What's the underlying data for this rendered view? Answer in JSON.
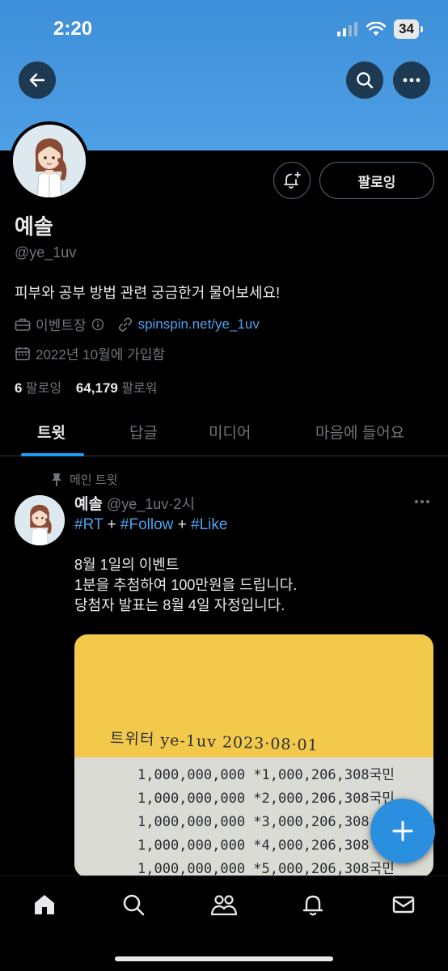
{
  "status_bar": {
    "time": "2:20",
    "battery": "34"
  },
  "header": {
    "back_icon": "back-arrow-icon",
    "search_icon": "search-icon",
    "more_icon": "more-icon"
  },
  "profile": {
    "display_name": "예솔",
    "handle": "@ye_1uv",
    "bio": "피부와 공부 방법 관련 궁금한거 물어보세요!",
    "category": "이벤트장",
    "link": "spinspin.net/ye_1uv",
    "joined": "2022년 10월에 가입함",
    "following_count": "6",
    "following_label": "팔로잉",
    "followers_count": "64,179",
    "followers_label": "팔로워",
    "follow_button": "팔로잉"
  },
  "tabs": [
    {
      "label": "트윗",
      "active": true
    },
    {
      "label": "답글",
      "active": false
    },
    {
      "label": "미디어",
      "active": false
    },
    {
      "label": "마음에 들어요",
      "active": false
    }
  ],
  "tweet": {
    "pinned_label": "메인 트윗",
    "author_name": "예솔",
    "author_handle": "@ye_1uv",
    "time": "·2시",
    "hashtag1": "#RT",
    "hashtag2": "#Follow",
    "hashtag3": "#Like",
    "plus": "+",
    "line1": "8월 1일의 이벤트",
    "line2": "1분을 추첨하여 100만원을 드립니다.",
    "line3": "당첨자 발표는 8월 4일 자정입니다.",
    "media_handwriting": "트위터 ye-1uv  2023·08·01",
    "media_rows": [
      "1,000,000,000 *1,000,206,308국민",
      "1,000,000,000 *2,000,206,308국민",
      "1,000,000,000 *3,000,206,308",
      "1,000,000,000 *4,000,206,308",
      "1,000,000,000 *5,000,206,308국민"
    ]
  },
  "colors": {
    "accent": "#1d9bf0",
    "link": "#4ea1ef",
    "banner": "#4e9fe4",
    "background": "#000000"
  },
  "bottom_nav": [
    "home-icon",
    "search-icon",
    "communities-icon",
    "notifications-icon",
    "messages-icon"
  ]
}
